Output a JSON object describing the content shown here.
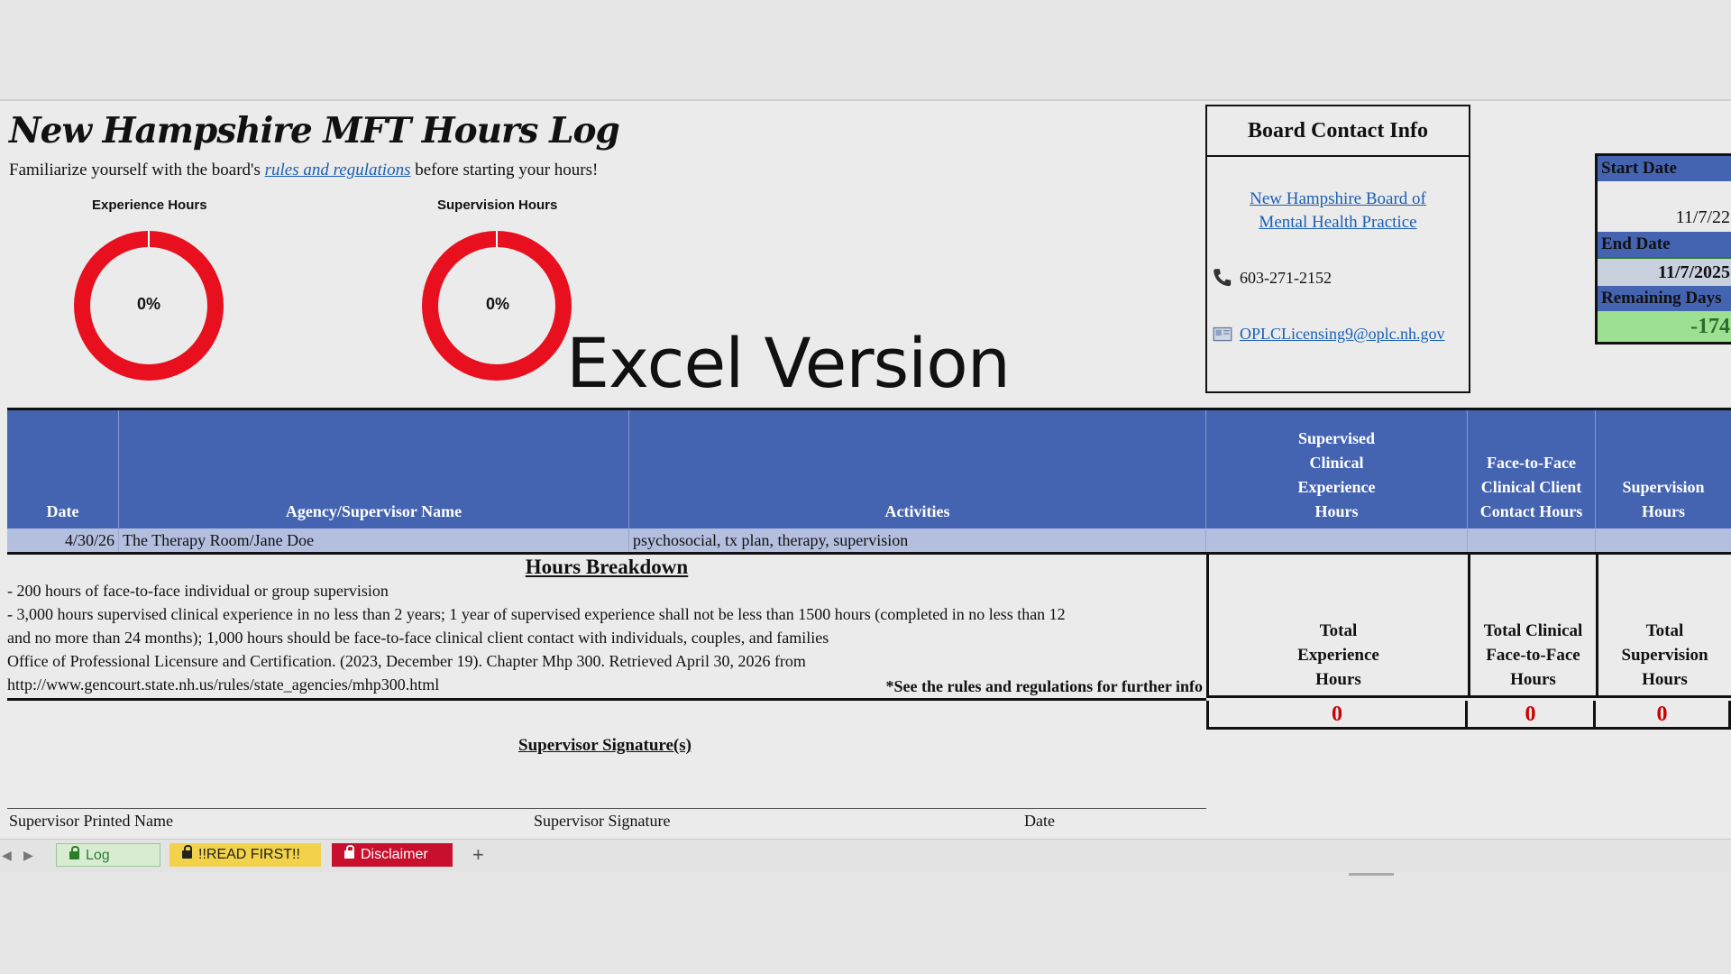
{
  "title": "New Hampshire MFT Hours Log",
  "intro": {
    "before": "Familiarize yourself with the board's ",
    "link": "rules and regulations",
    "after": " before starting your hours!"
  },
  "charts": {
    "experience": {
      "label": "Experience Hours",
      "percent_text": "0%",
      "percent": 0
    },
    "supervision": {
      "label": "Supervision Hours",
      "percent_text": "0%",
      "percent": 0
    }
  },
  "overlay_text": "Excel Version",
  "contact": {
    "title": "Board Contact Info",
    "board_link": "New Hampshire Board of Mental Health Practice",
    "phone": "603-271-2152",
    "email": "OPLCLicensing9@oplc.nh.gov"
  },
  "dates": {
    "start_label": "Start Date",
    "start_value": "11/7/22",
    "end_label": "End Date",
    "end_value": "11/7/2025",
    "remaining_label": "Remaining Days",
    "remaining_value": "-174"
  },
  "table": {
    "headers": {
      "date": "Date",
      "agency": "Agency/Supervisor Name",
      "activities": "Activities",
      "supervised": "Supervised Clinical Experience Hours",
      "face_to_face": "Face-to-Face Clinical Client Contact Hours",
      "supervision": "Supervision Hours"
    },
    "rows": [
      {
        "date": "4/30/26",
        "agency": "The Therapy Room/Jane Doe",
        "activities": "psychosocial, tx plan, therapy, supervision",
        "supervised": "",
        "face_to_face": "",
        "supervision": ""
      }
    ]
  },
  "breakdown": {
    "title": "Hours Breakdown",
    "lines": [
      "- 200 hours of face-to-face individual or group supervision",
      "- 3,000 hours supervised clinical experience in no less than 2 years; 1 year of supervised experience shall not be less than 1500 hours (completed in no less than 12",
      "and no more than 24 months); 1,000 hours should be face-to-face clinical client contact with individuals, couples, and families",
      "Office of Professional Licensure and Certification. (2023, December 19). Chapter Mhp 300. Retrieved April 30, 2026 from",
      "http://www.gencourt.state.nh.us/rules/state_agencies/mhp300.html"
    ],
    "note": "*See the rules and regulations for further info"
  },
  "totals": {
    "experience_label": "Total Experience Hours",
    "clinical_label": "Total Clinical Face-to-Face Hours",
    "supervision_label": "Total Supervision Hours",
    "experience_value": "0",
    "clinical_value": "0",
    "supervision_value": "0"
  },
  "signature": {
    "title": "Supervisor Signature(s)",
    "printed_name": "Supervisor Printed Name",
    "signature": "Supervisor Signature",
    "date": "Date"
  },
  "tabs": [
    {
      "label": "Log"
    },
    {
      "label": "!!READ FIRST!!"
    },
    {
      "label": "Disclaimer"
    }
  ],
  "add_tab": "+",
  "colors": {
    "header_blue": "#4464b2",
    "row_blue": "#b4bfdf",
    "donut_red": "#e8101e",
    "total_red": "#cc0000",
    "remaining_green": "#9ee092"
  },
  "icons": [
    "phone-icon",
    "email-icon",
    "lock-icon",
    "chevron-left-icon",
    "chevron-right-icon"
  ]
}
